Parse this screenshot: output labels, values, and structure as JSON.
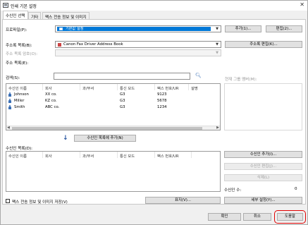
{
  "window": {
    "title": "인쇄 기본 설정",
    "close_glyph": "✕"
  },
  "tabs": [
    {
      "label": "수신인 선택",
      "active": true
    },
    {
      "label": "기타",
      "active": false
    },
    {
      "label": "팩스 전송 정보 및 이미지",
      "active": false
    }
  ],
  "profile": {
    "label": "프로파일(P):",
    "value": "기본값 설정",
    "add_label": "추가(1)...",
    "edit_label": "편집(2)..."
  },
  "address_book": {
    "label": "주소록 목록(B):",
    "value": "Canon Fax Driver Address Book",
    "edit_label": "주소록 편집(K)..."
  },
  "address_book_password": {
    "label": "주소 목록 암호(O):"
  },
  "address_list_label": "주소 목록(E):",
  "search": {
    "label": "검색(S):",
    "value": "",
    "icon": "search-icon"
  },
  "address_table": {
    "columns": [
      "수신인 이름",
      "회사",
      "과/부서",
      "통신 모드",
      "팩스 번호/UR",
      "설명"
    ],
    "rows": [
      {
        "name": "Johnson",
        "company": "XX co.",
        "dept": "",
        "mode": "G3",
        "fax": "9123",
        "desc": ""
      },
      {
        "name": "Miller",
        "company": "KZ co.",
        "dept": "",
        "mode": "G3",
        "fax": "5678",
        "desc": ""
      },
      {
        "name": "Smith",
        "company": "ABC co.",
        "dept": "",
        "mode": "G3",
        "fax": "1234",
        "desc": ""
      }
    ]
  },
  "group_members_label": "현재 그룹 멤버(M):",
  "add_to_recipients_label": "수신인 목록에 추가(N)",
  "recipient_list": {
    "label": "수신인 목록(D):",
    "columns": [
      "수신인 이름",
      "회사",
      "과/부서",
      "통신 모드",
      "팩스 번호/UR"
    ],
    "rows": []
  },
  "recipient_buttons": {
    "add": "수신인 추가(I)...",
    "edit": "수신인 편집(J)...",
    "delete": "삭제(L)"
  },
  "recipient_count": {
    "label": "수신인 수:",
    "value": "0"
  },
  "save_fax_info_label": "팩스 전송 정보 및 이미지 저장(V)",
  "display_label": "표지(V)...",
  "detail_settings_label": "세부 설정(Y)...",
  "footer": {
    "ok": "확인",
    "cancel": "취소",
    "help": "도움말"
  },
  "colors": {
    "selection": "#0078d7",
    "highlight_outline": "#e00000"
  }
}
